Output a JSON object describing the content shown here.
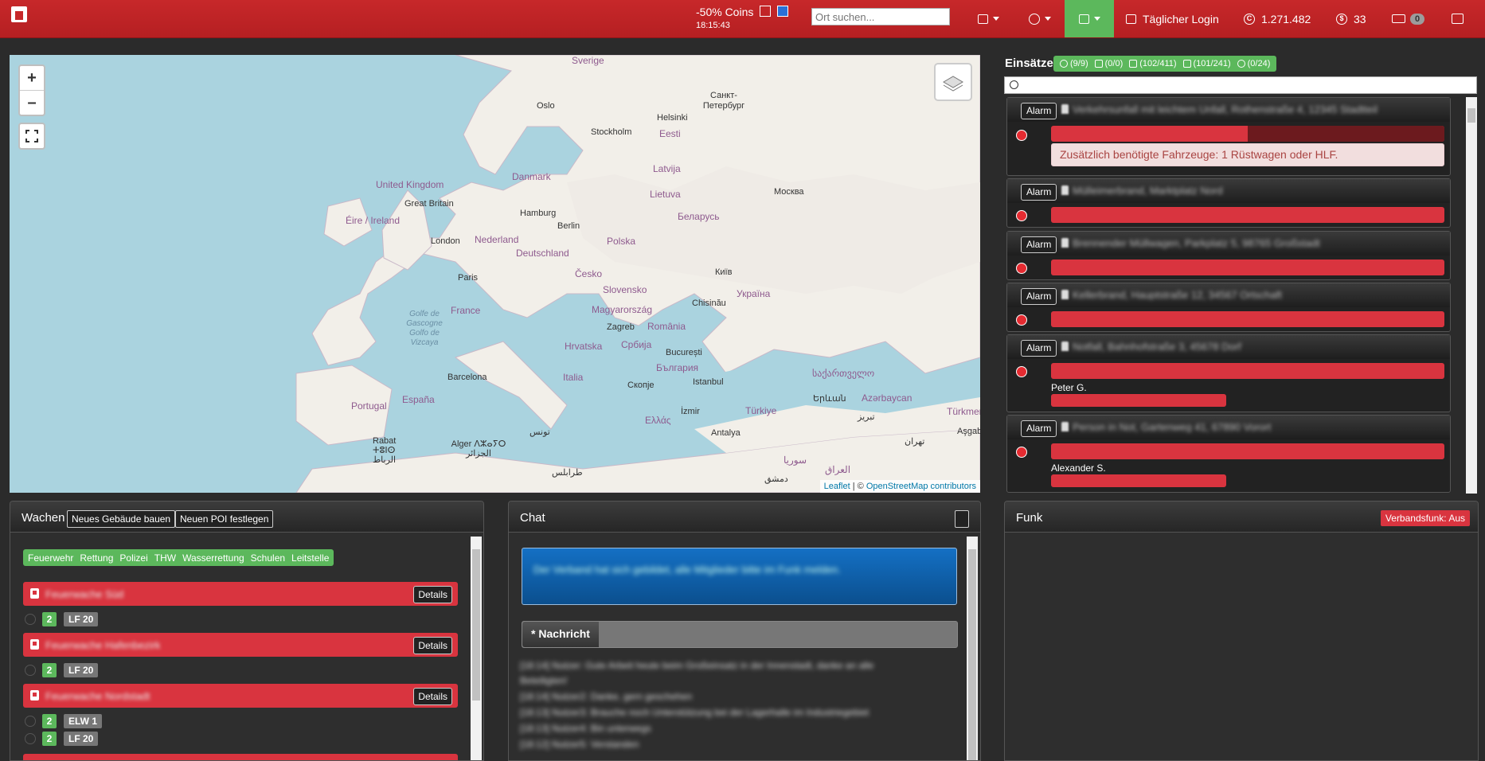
{
  "navbar": {
    "promo_text": "-50% Coins",
    "promo_time": "18:15:43",
    "search_placeholder": "Ort suchen...",
    "daily_login_label": "Täglicher Login",
    "credits": "1.271.482",
    "coins": "33",
    "messages_count": "0"
  },
  "map": {
    "zoom_in_label": "+",
    "zoom_out_label": "–",
    "attribution_leaflet": "Leaflet",
    "attribution_separator": " | © ",
    "attribution_osm": "OpenStreetMap contributors",
    "labels": [
      {
        "text": "Sverige",
        "cls": "country"
      },
      {
        "text": "Oslo",
        "cls": "city"
      },
      {
        "text": "Stockholm",
        "cls": "city"
      },
      {
        "text": "Helsinki",
        "cls": "city"
      },
      {
        "text": "Eesti",
        "cls": "country"
      },
      {
        "text": "Санкт-Петербург",
        "cls": "city"
      },
      {
        "text": "Danmark",
        "cls": "country"
      },
      {
        "text": "Latvija",
        "cls": "country"
      },
      {
        "text": "Lietuva",
        "cls": "country"
      },
      {
        "text": "United Kingdom",
        "cls": "country"
      },
      {
        "text": "Great Britain",
        "cls": "city"
      },
      {
        "text": "Éire / Ireland",
        "cls": "country"
      },
      {
        "text": "Hamburg",
        "cls": "city"
      },
      {
        "text": "Berlin",
        "cls": "city"
      },
      {
        "text": "Москва",
        "cls": "city"
      },
      {
        "text": "Беларусь",
        "cls": "country"
      },
      {
        "text": "London",
        "cls": "city"
      },
      {
        "text": "Nederland",
        "cls": "country"
      },
      {
        "text": "Deutschland",
        "cls": "country"
      },
      {
        "text": "Polska",
        "cls": "country"
      },
      {
        "text": "Paris",
        "cls": "city"
      },
      {
        "text": "Česko",
        "cls": "country"
      },
      {
        "text": "Київ",
        "cls": "city"
      },
      {
        "text": "France",
        "cls": "country"
      },
      {
        "text": "Slovensko",
        "cls": "country"
      },
      {
        "text": "Україна",
        "cls": "country"
      },
      {
        "text": "Magyarország",
        "cls": "country"
      },
      {
        "text": "Chisinău",
        "cls": "city"
      },
      {
        "text": "Golfe de Gascogne Golfo de Vizcaya",
        "cls": "sea"
      },
      {
        "text": "Zagreb",
        "cls": "city"
      },
      {
        "text": "România",
        "cls": "country"
      },
      {
        "text": "Hrvatska",
        "cls": "country"
      },
      {
        "text": "Србија",
        "cls": "country"
      },
      {
        "text": "București",
        "cls": "city"
      },
      {
        "text": "България",
        "cls": "country"
      },
      {
        "text": "Barcelona",
        "cls": "city"
      },
      {
        "text": "Italia",
        "cls": "country"
      },
      {
        "text": "Скопје",
        "cls": "city"
      },
      {
        "text": "Istanbul",
        "cls": "city"
      },
      {
        "text": "საქართველო",
        "cls": "country"
      },
      {
        "text": "Portugal",
        "cls": "country"
      },
      {
        "text": "España",
        "cls": "country"
      },
      {
        "text": "Ελλάς",
        "cls": "country"
      },
      {
        "text": "İzmir",
        "cls": "city"
      },
      {
        "text": "Türkiye",
        "cls": "country"
      },
      {
        "text": "Երևան",
        "cls": "city"
      },
      {
        "text": "Azərbaycan",
        "cls": "country"
      },
      {
        "text": "Türkmenistan",
        "cls": "country"
      },
      {
        "text": "Antalya",
        "cls": "city"
      },
      {
        "text": "تبريز",
        "cls": "city"
      },
      {
        "text": "Rabat ⵜⵓⵏⵙ الرباط",
        "cls": "city"
      },
      {
        "text": "Alger ⴷⵣⴰⵢⵔ الجزائر",
        "cls": "city"
      },
      {
        "text": "تونس",
        "cls": "city"
      },
      {
        "text": "طرابلس",
        "cls": "city"
      },
      {
        "text": "سوريا",
        "cls": "country"
      },
      {
        "text": "العراق",
        "cls": "country"
      },
      {
        "text": "دمشق",
        "cls": "city"
      },
      {
        "text": "تهران",
        "cls": "city"
      },
      {
        "text": "Aşgabat",
        "cls": "city"
      }
    ]
  },
  "einsaetze": {
    "title": "Einsätze",
    "counts": [
      "(9/9)",
      "(0/0)",
      "(102/411)",
      "(101/241)",
      "(0/24)"
    ],
    "alarm_label": "Alarm",
    "missions": [
      {
        "name": "Verkehrsunfall mit leichtem Unfall, Rothenstraße 4, 12345 Stadtteil",
        "progress": 0.5,
        "extra": "Zusätzlich benötigte Fahrzeuge: 1 Rüstwagen oder HLF.",
        "user": ""
      },
      {
        "name": "Mülleimerbrand, Marktplatz Nord",
        "progress": 0,
        "extra": "",
        "user": ""
      },
      {
        "name": "Brennender Müllwagen, Parkplatz 5, 98765 Großstadt",
        "progress": 0,
        "extra": "",
        "user": ""
      },
      {
        "name": "Kellerbrand, Hauptstraße 12, 34567 Ortschaft",
        "progress": 0,
        "extra": "",
        "user": ""
      },
      {
        "name": "Notfall, Bahnhofstraße 3, 45678 Dorf",
        "progress": 0,
        "extra": "",
        "user": "Peter G."
      },
      {
        "name": "Person in Not, Gartenweg 41, 67890 Vorort",
        "progress": 0,
        "extra": "",
        "user": "Alexander S."
      }
    ]
  },
  "wachen": {
    "title": "Wachen",
    "build_button": "Neues Gebäude bauen",
    "poi_button": "Neuen POI festlegen",
    "filters": [
      "Feuerwehr",
      "Rettung",
      "Polizei",
      "THW",
      "Wasserrettung",
      "Schulen",
      "Leitstelle"
    ],
    "details_label": "Details",
    "stations": [
      {
        "name": "Feuerwache Süd",
        "vehicles": [
          {
            "status": "2",
            "name": "LF 20"
          }
        ]
      },
      {
        "name": "Feuerwache Hafenbezirk",
        "vehicles": [
          {
            "status": "2",
            "name": "LF 20"
          }
        ]
      },
      {
        "name": "Feuerwache Nordstadt",
        "vehicles": [
          {
            "status": "2",
            "name": "ELW 1"
          },
          {
            "status": "2",
            "name": "LF 20"
          }
        ]
      }
    ]
  },
  "chat": {
    "title": "Chat",
    "info_text": "Der Verband hat sich gebildet, alle Mitglieder bitte im Funk melden.",
    "send_label": "* Nachricht",
    "messages": [
      "[18:14] Nutzer: Gute Arbeit heute beim Großeinsatz in der Innenstadt, danke an alle",
      "Beteiligten!",
      "[18:14] Nutzer2: Danke, gern geschehen",
      "[18:13] Nutzer3: Brauche noch Unterstützung bei der Lagerhalle im Industriegebiet",
      "[18:13] Nutzer4: Bin unterwegs",
      "[18:12] Nutzer5: Verstanden"
    ]
  },
  "funk": {
    "title": "Funk",
    "verbandsfunk_label": "Verbandsfunk: Aus"
  }
}
